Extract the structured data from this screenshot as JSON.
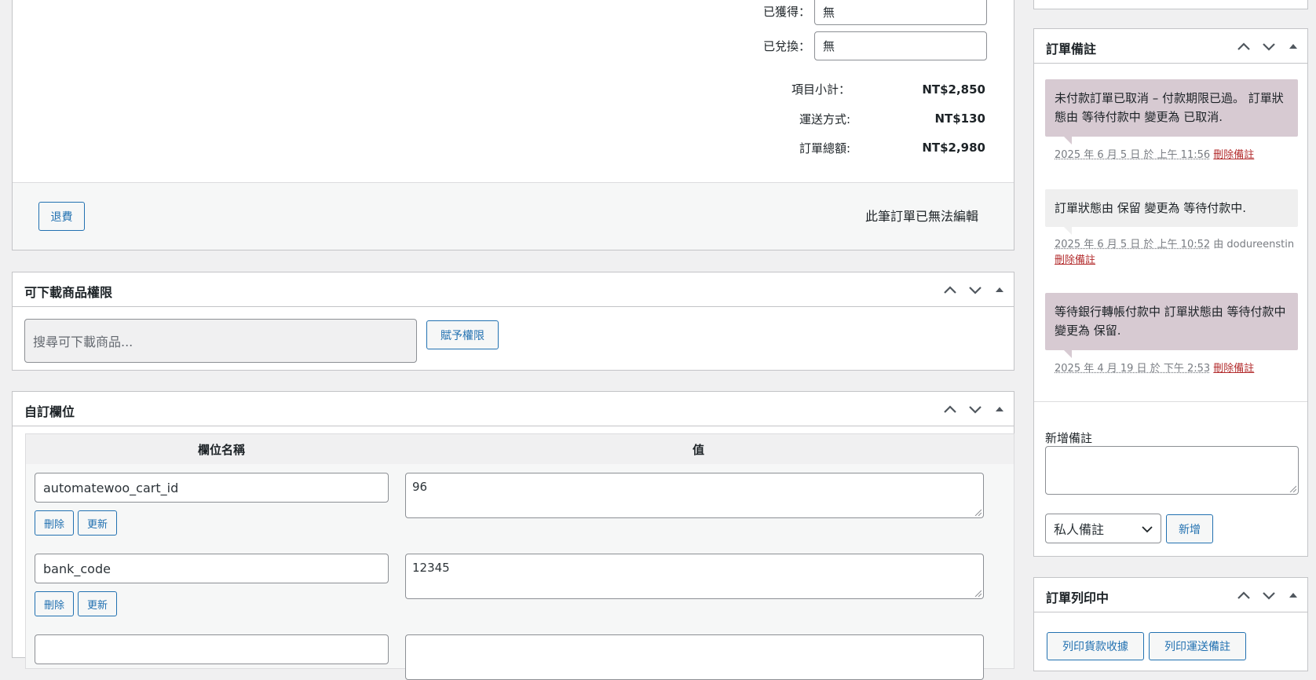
{
  "order_totals": {
    "earned_label": "已獲得：",
    "earned_value": "無",
    "redeemed_label": "已兌換：",
    "redeemed_value": "無",
    "subtotal_label": "項目小計：",
    "subtotal_value": "NT$2,850",
    "shipping_label": "運送方式:",
    "shipping_value": "NT$130",
    "total_label": "訂單總額:",
    "total_value": "NT$2,980",
    "refund_button": "退費",
    "not_editable_text": "此筆訂單已無法編輯"
  },
  "downloads": {
    "title": "可下載商品權限",
    "search_placeholder": "搜尋可下載商品...",
    "grant_button": "賦予權限"
  },
  "custom_fields": {
    "title": "自訂欄位",
    "col_name": "欄位名稱",
    "col_value": "值",
    "rows": [
      {
        "key": "automatewoo_cart_id",
        "value": "96",
        "delete": "刪除",
        "update": "更新"
      },
      {
        "key": "bank_code",
        "value": "12345",
        "delete": "刪除",
        "update": "更新"
      }
    ]
  },
  "order_notes": {
    "title": "訂單備註",
    "notes": [
      {
        "type": "customer",
        "text": "未付款訂單已取消 – 付款期限已過。 訂單狀態由 等待付款中 變更為 已取消.",
        "when": "2025 年 6 月 5 日 於 上午 11:56",
        "by": "",
        "delete": "刪除備註"
      },
      {
        "type": "system",
        "text": "訂單狀態由 保留 變更為 等待付款中.",
        "when": "2025 年 6 月 5 日 於 上午 10:52",
        "by": " 由 dodureenstin",
        "delete": "刪除備註"
      },
      {
        "type": "customer",
        "text": "等待銀行轉帳付款中 訂單狀態由 等待付款中 變更為 保留.",
        "when": "2025 年 4 月 19 日 於 下午 2:53",
        "by": "",
        "delete": "刪除備註"
      }
    ],
    "add_note_label": "新增備註",
    "note_type_selected": "私人備註",
    "add_button": "新增"
  },
  "order_print": {
    "title": "訂單列印中",
    "buttons": [
      "列印貨款收據",
      "列印運送備註"
    ]
  },
  "colors": {
    "accent": "#2271b1",
    "delete": "#b32d2e",
    "customer_note_bg": "#d7cad2",
    "system_note_bg": "#efefef"
  }
}
